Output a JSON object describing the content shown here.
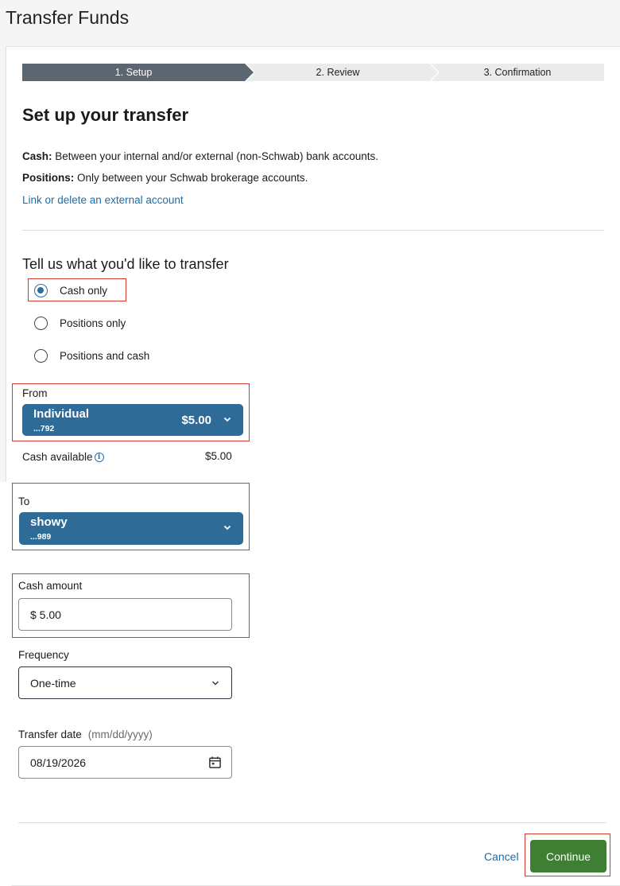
{
  "page_title": "Transfer Funds",
  "stepper": {
    "steps": [
      "1. Setup",
      "2. Review",
      "3. Confirmation"
    ],
    "active_index": 0
  },
  "setup": {
    "title": "Set up your transfer",
    "cash_label": "Cash:",
    "cash_text": " Between your internal and/or external (non-Schwab) bank accounts.",
    "positions_label": "Positions:",
    "positions_text": " Only between your Schwab brokerage accounts.",
    "link": "Link or delete an external account"
  },
  "transfer_type": {
    "question": "Tell us what you'd like to transfer",
    "options": [
      {
        "label": "Cash only",
        "checked": true
      },
      {
        "label": "Positions only",
        "checked": false
      },
      {
        "label": "Positions and cash",
        "checked": false
      }
    ]
  },
  "from": {
    "label": "From",
    "account_name": "Individual",
    "account_number": "...792",
    "balance": "$5.00",
    "cash_available_label": "Cash available",
    "cash_available_value": "$5.00"
  },
  "to": {
    "label": "To",
    "account_name": "showy",
    "account_number": "...989"
  },
  "cash_amount": {
    "label": "Cash amount",
    "value": "$ 5.00"
  },
  "frequency": {
    "label": "Frequency",
    "value": "One-time"
  },
  "transfer_date": {
    "label": "Transfer date",
    "hint": "(mm/dd/yyyy)",
    "value": "08/19/2026"
  },
  "actions": {
    "cancel": "Cancel",
    "continue": "Continue"
  },
  "colors": {
    "accent_blue": "#2e6b96",
    "link_blue": "#1a6da8",
    "continue_green": "#3e7f33",
    "highlight_red": "#d33a2c",
    "stepper_active": "#5b6670"
  }
}
